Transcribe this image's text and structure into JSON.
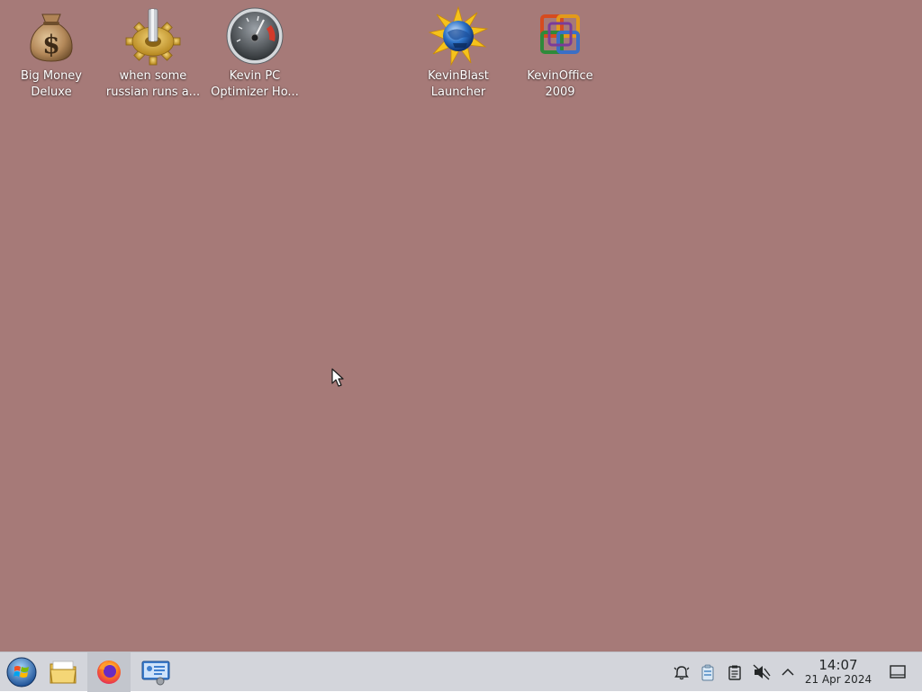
{
  "desktop": {
    "background_color": "#a67a78",
    "icons": [
      {
        "name": "money-bag-icon",
        "label_lines": [
          "Big Money",
          "Deluxe"
        ]
      },
      {
        "name": "gear-icon",
        "label_lines": [
          "when some",
          "russian runs a..."
        ]
      },
      {
        "name": "speedometer-icon",
        "label_lines": [
          "Kevin PC",
          "Optimizer Ho..."
        ]
      },
      {
        "name": "globe-burst-icon",
        "label_lines": [
          "KevinBlast",
          "Launcher"
        ]
      },
      {
        "name": "office-logo-icon",
        "label_lines": [
          "KevinOffice",
          "2009"
        ]
      }
    ]
  },
  "taskbar": {
    "background_color": "#d3d5db",
    "launchers": [
      {
        "name": "start-menu-icon"
      },
      {
        "name": "file-manager-icon"
      },
      {
        "name": "firefox-icon",
        "active": true
      },
      {
        "name": "system-settings-icon"
      }
    ],
    "tray": [
      {
        "name": "notifications-icon"
      },
      {
        "name": "clipboard-bin-icon"
      },
      {
        "name": "clipboard-icon"
      },
      {
        "name": "volume-muted-icon"
      },
      {
        "name": "chevron-up-icon"
      }
    ],
    "clock": {
      "time": "14:07",
      "date": "21 Apr 2024"
    },
    "show_desktop": {
      "name": "show-desktop-icon"
    }
  }
}
